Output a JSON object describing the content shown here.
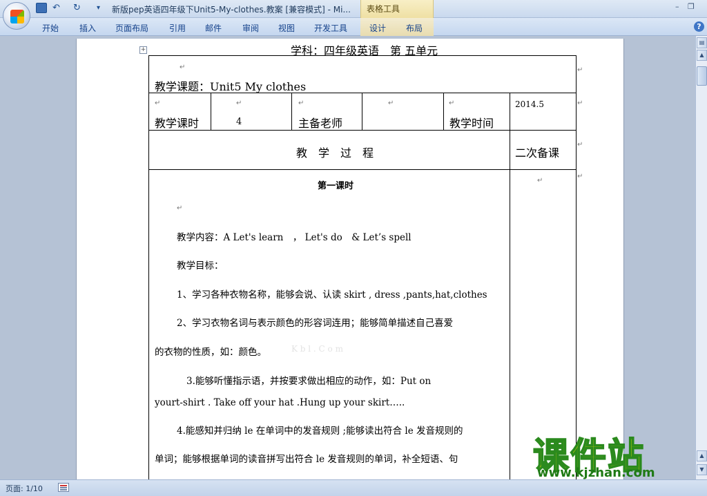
{
  "window": {
    "title": "新版pep英语四年级下Unit5-My-clothes.教案 [兼容模式] - Mi...",
    "context_tab": "表格工具",
    "minimize": "–",
    "restore": "❐"
  },
  "quick_access": {
    "undo": "↶",
    "redo": "↻",
    "more": "▾"
  },
  "ribbon": {
    "tabs": [
      "开始",
      "插入",
      "页面布局",
      "引用",
      "邮件",
      "审阅",
      "视图",
      "开发工具",
      "设计",
      "布局"
    ],
    "help": "?"
  },
  "document": {
    "heading": "学科：四年级英语　第 五单元",
    "topic": "教学课题：Unit5 My clothes",
    "hours_label": "教学课时",
    "hours_value": "4",
    "teacher_label": "主备老师",
    "teacher_value": "",
    "date_label": "教学时间",
    "date_value": "2014.5",
    "process_header": "教　学　过　程",
    "second_prep_header": "二次备课",
    "lesson_title": "第一课时",
    "lines": [
      "教学内容：A Let's learn　， Let's do　& Let’s spell",
      "教学目标：",
      "1、学习各种衣物名称，能够会说、认读 skirt , dress ,pants,hat,clothes",
      "2、学习衣物名词与表示颜色的形容词连用；能够简单描述自己喜爱",
      "的衣物的性质，如：颜色。",
      "3.能够听懂指示语，并按要求做出相应的动作，如：Put on",
      "yourt-shirt . Take off your hat .Hung up your skirt…..",
      "4.能感知并归纳 le 在单词中的发音规则 ;能够读出符合 le 发音规则的",
      "单词；能够根据单词的读音拼写出符合 le 发音规则的单词，补全短语、句"
    ],
    "faint_watermark": "K b l . C o m"
  },
  "status_bar": {
    "page": "页面: 1/10"
  },
  "watermark": {
    "brand": "课件站",
    "url": "www.kjzhan.com"
  },
  "colors": {
    "ribbon_text": "#15428b",
    "context_tab": "#efe0a4",
    "watermark_fill": "#f5e600",
    "watermark_stroke": "#2b8a1e"
  }
}
